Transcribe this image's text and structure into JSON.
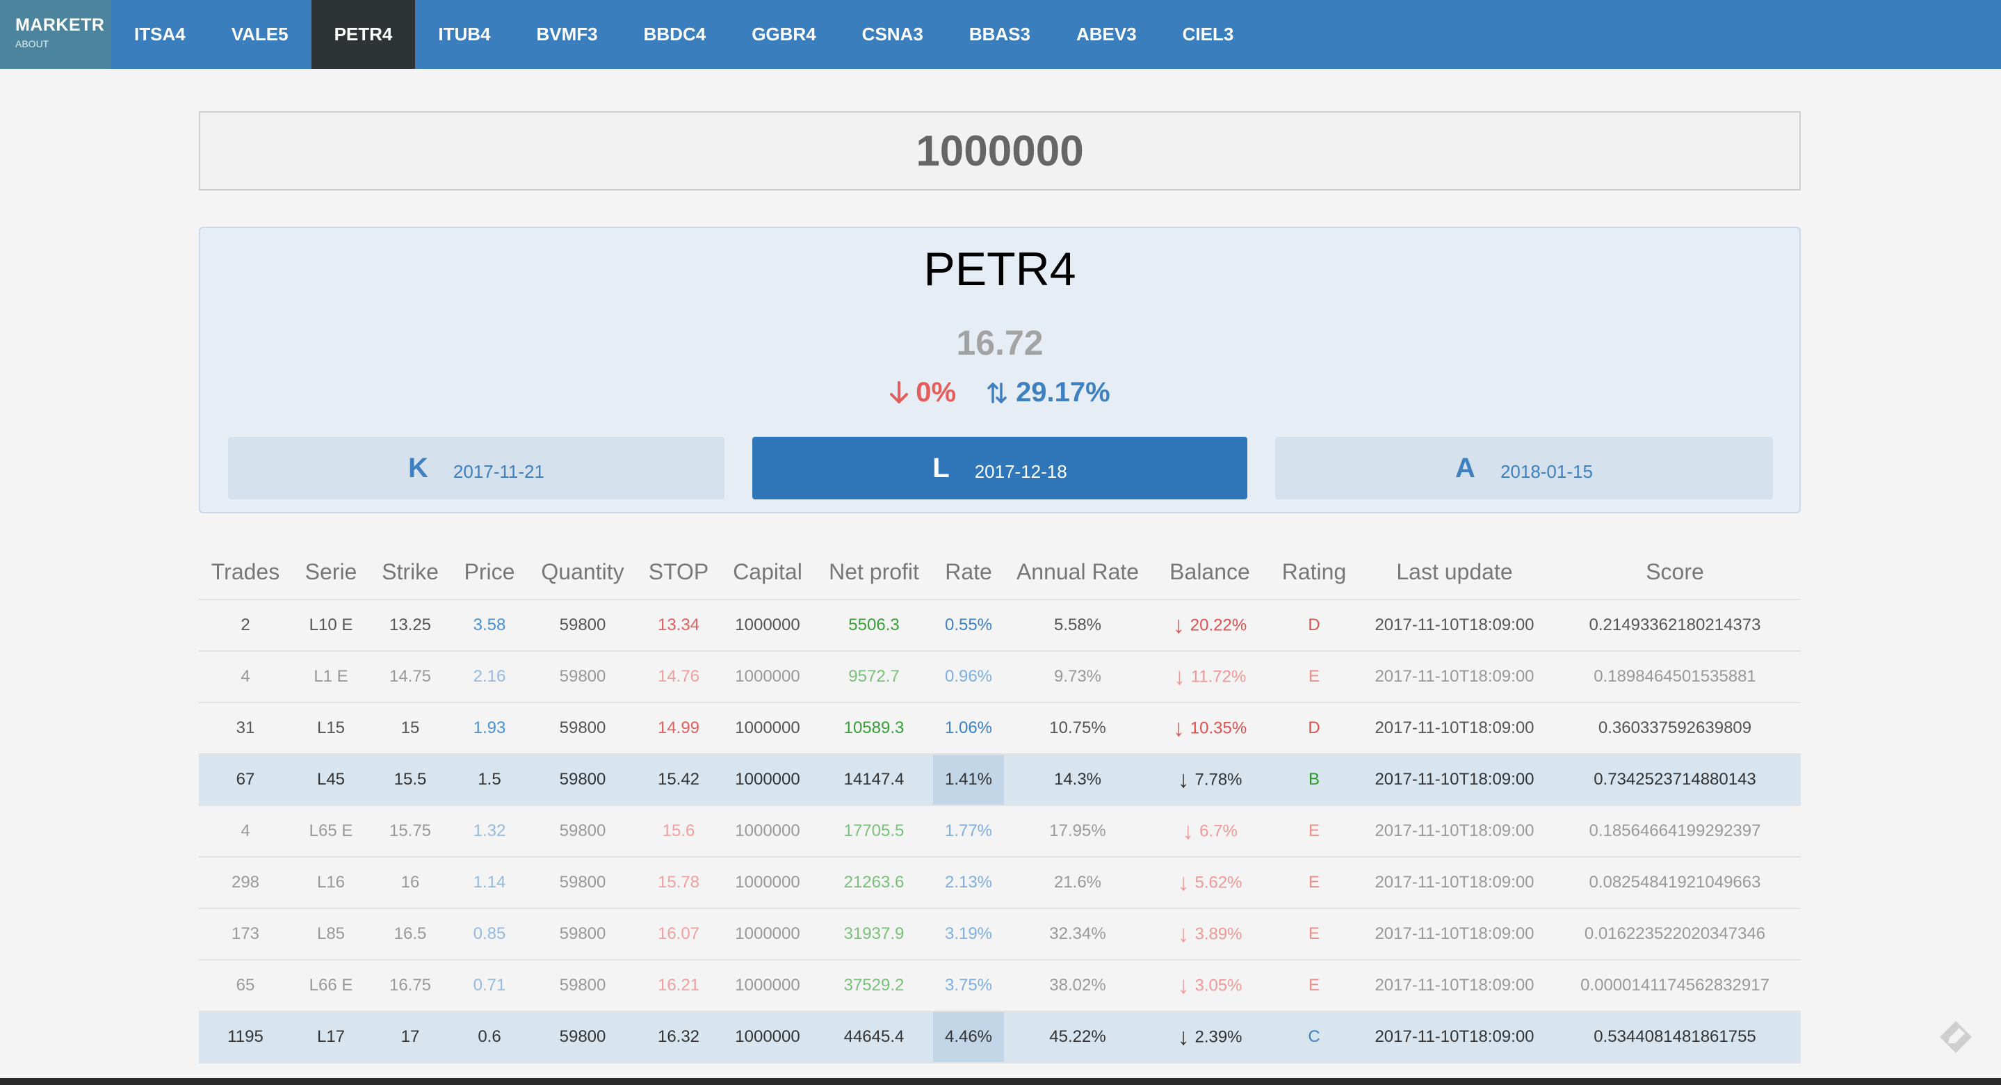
{
  "nav": {
    "brand": "MARKETR",
    "brand_sub": "ABOUT",
    "tabs": [
      {
        "label": "ITSA4"
      },
      {
        "label": "VALE5"
      },
      {
        "label": "PETR4",
        "active": true
      },
      {
        "label": "ITUB4"
      },
      {
        "label": "BVMF3"
      },
      {
        "label": "BBDC4"
      },
      {
        "label": "GGBR4"
      },
      {
        "label": "CSNA3"
      },
      {
        "label": "BBAS3"
      },
      {
        "label": "ABEV3"
      },
      {
        "label": "CIEL3"
      }
    ]
  },
  "capital": {
    "value": "1000000"
  },
  "stock": {
    "ticker": "PETR4",
    "price": "16.72",
    "change_down": "0%",
    "change_updown": "29.17%",
    "expirations": [
      {
        "letter": "K",
        "date": "2017-11-21"
      },
      {
        "letter": "L",
        "date": "2017-12-18",
        "active": true
      },
      {
        "letter": "A",
        "date": "2018-01-15"
      }
    ]
  },
  "table": {
    "headers": [
      "Trades",
      "Serie",
      "Strike",
      "Price",
      "Quantity",
      "STOP",
      "Capital",
      "Net profit",
      "Rate",
      "Annual Rate",
      "Balance",
      "Rating",
      "Last update",
      "Score"
    ],
    "rows": [
      {
        "trades": "2",
        "serie": "L10 E",
        "strike": "13.25",
        "price": "3.58",
        "quantity": "59800",
        "stop": "13.34",
        "capital": "1000000",
        "net": "5506.3",
        "rate": "0.55%",
        "annual": "5.58%",
        "balance": "20.22%",
        "rating": "D",
        "updated": "2017-11-10T18:09:00",
        "score": "0.21493362180214373",
        "style": "normal"
      },
      {
        "trades": "4",
        "serie": "L1 E",
        "strike": "14.75",
        "price": "2.16",
        "quantity": "59800",
        "stop": "14.76",
        "capital": "1000000",
        "net": "9572.7",
        "rate": "0.96%",
        "annual": "9.73%",
        "balance": "11.72%",
        "rating": "E",
        "updated": "2017-11-10T18:09:00",
        "score": "0.1898464501535881",
        "style": "faded"
      },
      {
        "trades": "31",
        "serie": "L15",
        "strike": "15",
        "price": "1.93",
        "quantity": "59800",
        "stop": "14.99",
        "capital": "1000000",
        "net": "10589.3",
        "rate": "1.06%",
        "annual": "10.75%",
        "balance": "10.35%",
        "rating": "D",
        "updated": "2017-11-10T18:09:00",
        "score": "0.360337592639809",
        "style": "normal"
      },
      {
        "trades": "67",
        "serie": "L45",
        "strike": "15.5",
        "price": "1.5",
        "quantity": "59800",
        "stop": "15.42",
        "capital": "1000000",
        "net": "14147.4",
        "rate": "1.41%",
        "annual": "14.3%",
        "balance": "7.78%",
        "rating": "B",
        "updated": "2017-11-10T18:09:00",
        "score": "0.7342523714880143",
        "style": "hl"
      },
      {
        "trades": "4",
        "serie": "L65 E",
        "strike": "15.75",
        "price": "1.32",
        "quantity": "59800",
        "stop": "15.6",
        "capital": "1000000",
        "net": "17705.5",
        "rate": "1.77%",
        "annual": "17.95%",
        "balance": "6.7%",
        "rating": "E",
        "updated": "2017-11-10T18:09:00",
        "score": "0.18564664199292397",
        "style": "faded"
      },
      {
        "trades": "298",
        "serie": "L16",
        "strike": "16",
        "price": "1.14",
        "quantity": "59800",
        "stop": "15.78",
        "capital": "1000000",
        "net": "21263.6",
        "rate": "2.13%",
        "annual": "21.6%",
        "balance": "5.62%",
        "rating": "E",
        "updated": "2017-11-10T18:09:00",
        "score": "0.08254841921049663",
        "style": "faded"
      },
      {
        "trades": "173",
        "serie": "L85",
        "strike": "16.5",
        "price": "0.85",
        "quantity": "59800",
        "stop": "16.07",
        "capital": "1000000",
        "net": "31937.9",
        "rate": "3.19%",
        "annual": "32.34%",
        "balance": "3.89%",
        "rating": "E",
        "updated": "2017-11-10T18:09:00",
        "score": "0.016223522020347346",
        "style": "faded"
      },
      {
        "trades": "65",
        "serie": "L66 E",
        "strike": "16.75",
        "price": "0.71",
        "quantity": "59800",
        "stop": "16.21",
        "capital": "1000000",
        "net": "37529.2",
        "rate": "3.75%",
        "annual": "38.02%",
        "balance": "3.05%",
        "rating": "E",
        "updated": "2017-11-10T18:09:00",
        "score": "0.0000141174562832917",
        "style": "faded"
      },
      {
        "trades": "1195",
        "serie": "L17",
        "strike": "17",
        "price": "0.6",
        "quantity": "59800",
        "stop": "16.32",
        "capital": "1000000",
        "net": "44645.4",
        "rate": "4.46%",
        "annual": "45.22%",
        "balance": "2.39%",
        "rating": "C",
        "updated": "2017-11-10T18:09:00",
        "score": "0.5344081481861755",
        "style": "hl"
      }
    ]
  },
  "colors": {
    "nav": "#3a7ebd",
    "active_tab": "#2e3335",
    "accent": "#2f76b8",
    "loss": "#e05050",
    "gain": "#3a9d3a"
  },
  "icons": {
    "corner": "pencil-diamond-icon",
    "down": "arrow-down-icon",
    "updown": "arrow-updown-icon"
  }
}
